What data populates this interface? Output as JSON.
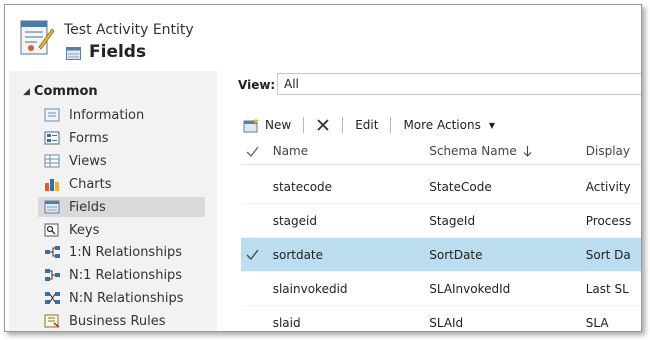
{
  "header": {
    "entity_name": "Test Activity Entity",
    "page_title": "Fields"
  },
  "sidebar": {
    "group_label": "Common",
    "items": [
      {
        "label": "Information",
        "icon": "information-icon"
      },
      {
        "label": "Forms",
        "icon": "forms-icon"
      },
      {
        "label": "Views",
        "icon": "views-icon"
      },
      {
        "label": "Charts",
        "icon": "charts-icon"
      },
      {
        "label": "Fields",
        "icon": "fields-icon",
        "selected": true
      },
      {
        "label": "Keys",
        "icon": "keys-icon"
      },
      {
        "label": "1:N Relationships",
        "icon": "one-to-many-icon"
      },
      {
        "label": "N:1 Relationships",
        "icon": "many-to-one-icon"
      },
      {
        "label": "N:N Relationships",
        "icon": "many-to-many-icon"
      },
      {
        "label": "Business Rules",
        "icon": "business-rules-icon"
      }
    ]
  },
  "view": {
    "label": "View:",
    "value": "All"
  },
  "toolbar": {
    "new_label": "New",
    "edit_label": "Edit",
    "more_actions_label": "More Actions"
  },
  "grid": {
    "columns": {
      "name": "Name",
      "schema_name": "Schema Name",
      "display": "Display"
    },
    "rows": [
      {
        "name": "statecode",
        "schema": "StateCode",
        "display": "Activity"
      },
      {
        "name": "stageid",
        "schema": "StageId",
        "display": "Process"
      },
      {
        "name": "sortdate",
        "schema": "SortDate",
        "display": "Sort Da",
        "selected": true
      },
      {
        "name": "slainvokedid",
        "schema": "SLAInvokedId",
        "display": "Last SL"
      },
      {
        "name": "slaid",
        "schema": "SLAId",
        "display": "SLA"
      }
    ]
  },
  "colors": {
    "selected_row": "#bcdcef",
    "sidebar_bg": "#f2f2f2",
    "sidebar_selected": "#d9d9d9"
  }
}
